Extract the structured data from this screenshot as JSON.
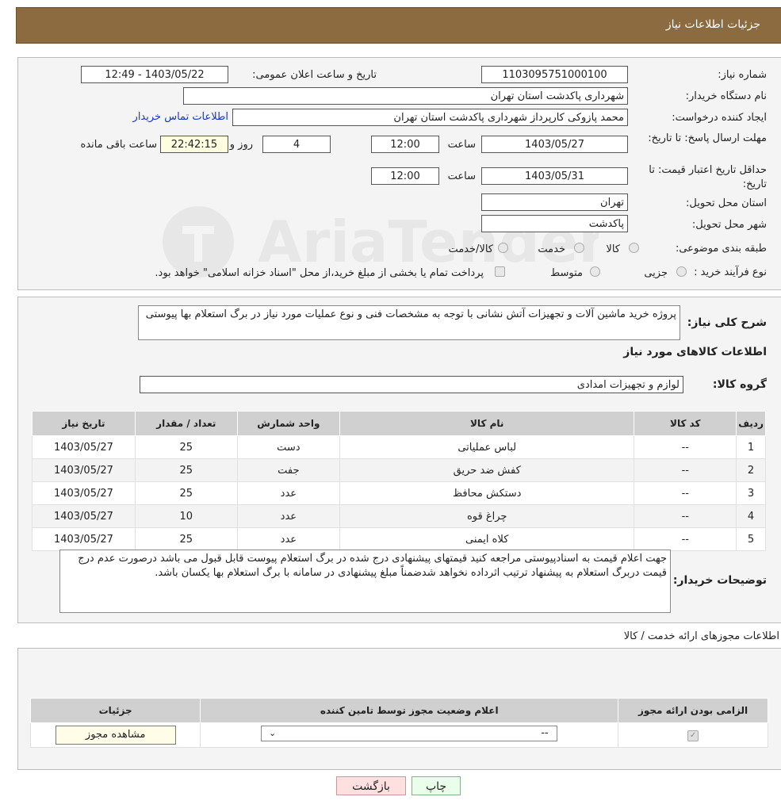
{
  "header": {
    "title": "جزئیات اطلاعات نیاز"
  },
  "form": {
    "need_number_label": "شماره نیاز:",
    "need_number": "1103095751000100",
    "announce_label": "تاریخ و ساعت اعلان عمومی:",
    "announce_value": "1403/05/22 - 12:49",
    "buyer_org_label": "نام دستگاه خریدار:",
    "buyer_org": "شهرداری پاکدشت استان تهران",
    "requester_label": "ایجاد کننده درخواست:",
    "requester": "محمد پازوکی کارپرداز شهرداری پاکدشت استان تهران",
    "contact_link": "اطلاعات تماس خریدار",
    "deadline_label": "مهلت ارسال پاسخ: تا تاریخ:",
    "deadline_date": "1403/05/27",
    "time_label": "ساعت",
    "deadline_time": "12:00",
    "days": "4",
    "days_label": "روز و",
    "remaining": "22:42:15",
    "remaining_label": "ساعت باقی مانده",
    "min_validity_label": "حداقل تاریخ اعتبار قیمت: تا تاریخ:",
    "validity_date": "1403/05/31",
    "validity_time": "12:00",
    "province_label": "استان محل تحویل:",
    "province": "تهران",
    "city_label": "شهر محل تحویل:",
    "city": "پاکدشت",
    "category_label": "طبقه بندی موضوعی:",
    "category_options": [
      "کالا",
      "خدمت",
      "کالا/خدمت"
    ],
    "process_label": "نوع فرآیند خرید :",
    "process_options": [
      "جزیی",
      "متوسط"
    ],
    "process_note": "پرداخت تمام یا بخشی از مبلغ خرید،از محل \"اسناد خزانه اسلامی\" خواهد بود."
  },
  "watermark": {
    "text": "AriaTender.neT"
  },
  "summary": {
    "label": "شرح کلی نیاز:",
    "text": "پروژه خرید ماشین آلات و تجهیزات آتش نشانی با توجه به مشخصات فنی و نوع عملیات مورد نیاز در برگ استعلام بها پیوستی",
    "goods_title": "اطلاعات کالاهای مورد نیاز",
    "group_label": "گروه کالا:",
    "group_value": "لوازم و تجهیزات امدادی"
  },
  "goods_table": {
    "headers": [
      "ردیف",
      "کد کالا",
      "نام کالا",
      "واحد شمارش",
      "تعداد / مقدار",
      "تاریخ نیاز"
    ],
    "rows": [
      [
        "1",
        "--",
        "لباس عملیاتی",
        "دست",
        "25",
        "1403/05/27"
      ],
      [
        "2",
        "--",
        "کفش ضد حریق",
        "جفت",
        "25",
        "1403/05/27"
      ],
      [
        "3",
        "--",
        "دستکش محافظ",
        "عدد",
        "25",
        "1403/05/27"
      ],
      [
        "4",
        "--",
        "چراغ قوه",
        "عدد",
        "10",
        "1403/05/27"
      ],
      [
        "5",
        "--",
        "کلاه ایمنی",
        "عدد",
        "25",
        "1403/05/27"
      ]
    ]
  },
  "buyer_notes": {
    "label": "توضیحات خریدار:",
    "text": "جهت اعلام قیمت به اسنادپیوستی مراجعه کنید قیمتهای پیشنهادی درج شده در برگ استعلام پیوست قابل قبول می باشد درصورت عدم درج قیمت دربرگ استعلام به پیشنهاد ترتیب اثرداده نخواهد شدضمناً مبلغ پیشنهادی در سامانه با برگ استعلام بها یکسان باشد."
  },
  "permits": {
    "title": "اطلاعات مجوزهای ارائه خدمت / کالا",
    "headers": [
      "الزامی بودن ارائه مجوز",
      "اعلام وضعیت مجوز توسط تامین کننده",
      "جزئیات"
    ],
    "select_value": "--",
    "view_button": "مشاهده مجوز"
  },
  "actions": {
    "print": "چاپ",
    "back": "بازگشت"
  }
}
